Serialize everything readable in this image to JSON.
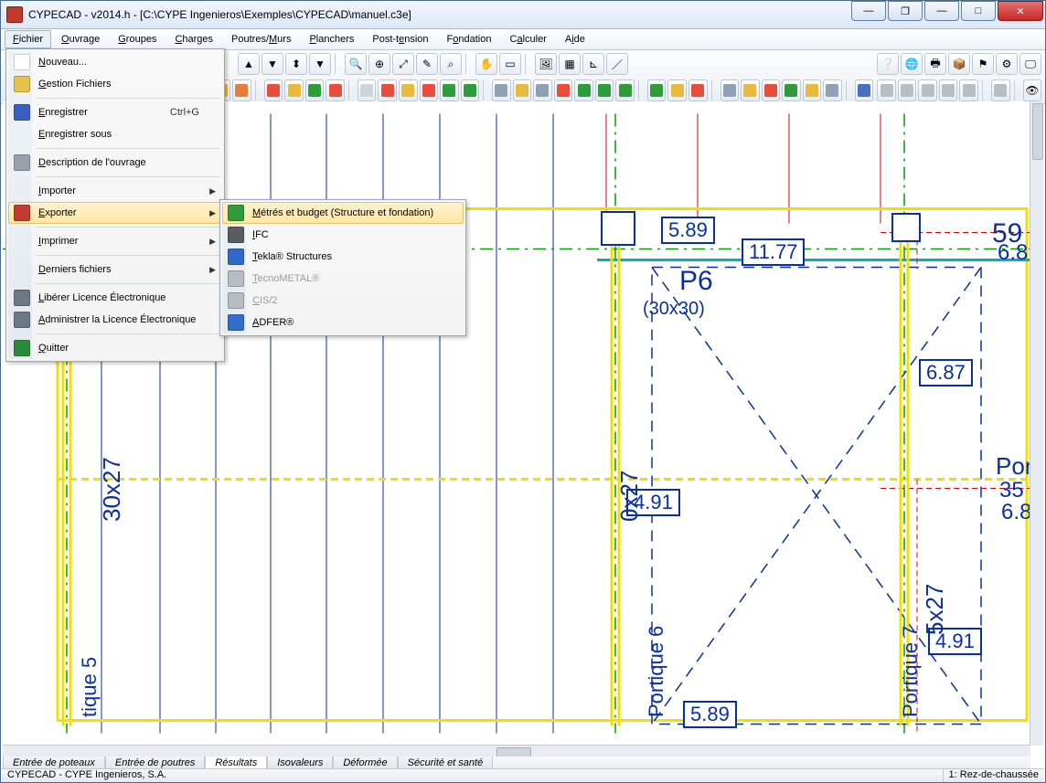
{
  "window": {
    "title": "CYPECAD - v2014.h - [C:\\CYPE Ingenieros\\Exemples\\CYPECAD\\manuel.c3e]"
  },
  "menus": {
    "items": [
      "Fichier",
      "Ouvrage",
      "Groupes",
      "Charges",
      "Poutres/Murs",
      "Planchers",
      "Post-tension",
      "Fondation",
      "Calculer",
      "Aide"
    ],
    "open_index": 0
  },
  "fichier_menu": {
    "items": [
      {
        "label": "Nouveau...",
        "icon": "#ffffff",
        "enabled": true
      },
      {
        "label": "Gestion Fichiers",
        "icon": "#e6c24a",
        "enabled": true
      },
      {
        "sep": true
      },
      {
        "label": "Enregistrer",
        "shortcut": "Ctrl+G",
        "icon": "#3a5fc0",
        "enabled": true
      },
      {
        "label": "Enregistrer sous",
        "enabled": true
      },
      {
        "sep": true
      },
      {
        "label": "Description de l'ouvrage",
        "icon": "#9aa0aa",
        "enabled": true
      },
      {
        "sep": true
      },
      {
        "label": "Importer",
        "submenu": true,
        "enabled": true
      },
      {
        "label": "Exporter",
        "submenu": true,
        "enabled": true,
        "highlight": true,
        "icon": "#c33a2f"
      },
      {
        "sep": true
      },
      {
        "label": "Imprimer",
        "submenu": true,
        "enabled": true
      },
      {
        "sep": true
      },
      {
        "label": "Derniers fichiers",
        "submenu": true,
        "enabled": true
      },
      {
        "sep": true
      },
      {
        "label": "Libérer Licence Électronique",
        "icon": "#6b7885",
        "enabled": true
      },
      {
        "label": "Administrer la Licence Électronique",
        "icon": "#6b7885",
        "enabled": true
      },
      {
        "sep": true
      },
      {
        "label": "Quitter",
        "icon": "#2a8a3a",
        "enabled": true
      }
    ]
  },
  "exporter_submenu": {
    "items": [
      {
        "label": "Métrés et budget (Structure et fondation)",
        "enabled": true,
        "highlight": true,
        "icon": "#2f9c3c"
      },
      {
        "label": "IFC",
        "enabled": true,
        "icon": "#5a5d60"
      },
      {
        "label": "Tekla® Structures",
        "enabled": true,
        "icon": "#2f69c9"
      },
      {
        "label": "TecnoMETAL®",
        "enabled": false,
        "icon": "#b8bcc0"
      },
      {
        "label": "CIS/2",
        "enabled": false,
        "icon": "#b8bcc0"
      },
      {
        "label": "ADFER®",
        "enabled": true,
        "icon": "#2f6fc9"
      }
    ]
  },
  "canvas_labels": {
    "p6": "P6",
    "p6_sub": "(30x30)",
    "portique_right": "Portique",
    "portique6": "Portique 6",
    "portique7": "Portique 7",
    "tique5": "tique 5",
    "size_30x27_left": "30x27",
    "size_0x27": "0x27",
    "size_5x27": "5x27",
    "n_5_89_top": "5.89",
    "n_11_77": "11.77",
    "n_6_87": "6.87",
    "n_4_91_a": "4.91",
    "n_4_91_b": "4.91",
    "n_5_89_bot": "5.89",
    "n_59": "59",
    "n_68_a": "6.8",
    "n_35": "35",
    "n_68_b": "6.8"
  },
  "bottom_tabs": {
    "items": [
      "Entrée de poteaux",
      "Entrée de poutres",
      "Résultats",
      "Isovaleurs",
      "Déformée",
      "Sécurité et santé"
    ],
    "active_index": 2
  },
  "status": {
    "left": "CYPECAD - CYPE Ingenieros, S.A.",
    "right": "1: Rez-de-chaussée"
  },
  "colors": {
    "blue": "#0a2fa2",
    "yellow": "#f0e000",
    "green": "#00a000",
    "cyan": "#00b0d0",
    "red": "#e00000",
    "dashred": "#e00000"
  }
}
